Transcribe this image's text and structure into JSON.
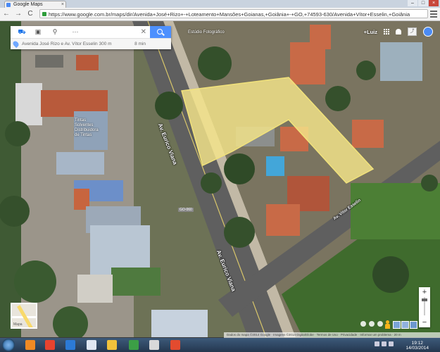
{
  "window": {
    "tab_title": "Google Maps",
    "tab_close": "×",
    "controls": {
      "minimize": "–",
      "maximize": "□",
      "close": "×"
    }
  },
  "browser": {
    "back": "←",
    "forward": "→",
    "reload": "C",
    "url": "https://www.google.com.br/maps/dir/Avenida+José+Rizo+-+Loteamento+Mansões+Goianas,+Goiânia+-+GO,+74593-630/Avenida+Vítor+Esselin,+Goiânia"
  },
  "directions": {
    "modes": [
      "car",
      "transit",
      "walk",
      "more"
    ],
    "mode_glyphs": [
      "⛟",
      "▣",
      "⚲",
      "···"
    ],
    "active_mode": 0,
    "close": "✕",
    "route_text": "Avenida José Rizo e Av. Vítor Esselin 300 m",
    "distance": "8 min"
  },
  "account": {
    "plus_label": "+Luiz",
    "share_glyph": "⤴"
  },
  "labels": {
    "top_place": "Estúdio Fotográfico",
    "business": "Tintas Solventes Distribuidora de Tintas",
    "road_main": "Av. Eurico Viana",
    "road_side": "Av. Vitor Esselin",
    "road_bottom": "Av. Eurico Viana",
    "shield": "GO-060"
  },
  "map_controls": {
    "zoom_in": "+",
    "zoom_out": "−",
    "minimap_label": "Mapa"
  },
  "attribution": "Dados do mapa ©2014 Google · Imagens ©2014 DigitalGlobe · Termos de Uso · Privacidade · Informar um problema · 20 m",
  "taskbar": {
    "app_icons": [
      "#f08a24",
      "#e8432f",
      "#2c7ad6",
      "#dfe7f2",
      "#f3c33b",
      "#3c9f46",
      "#d9d9d9",
      "#e34b2f"
    ],
    "time": "19:12",
    "date": "14/03/2014"
  }
}
